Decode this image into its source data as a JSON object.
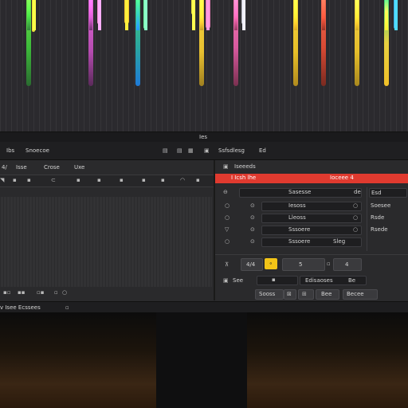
{
  "window": {
    "title": "Ies",
    "app_name": "Ibs",
    "menu_label": "Snoecoe",
    "header_right": "Ssfsdlesg",
    "header_right_tag": "Ed"
  },
  "toolbar": {
    "item1": "4/",
    "item2": "Isse",
    "item3": "Crose",
    "item4": "Uxe"
  },
  "right_panel": {
    "section_title": "Iseeeds",
    "alert_left": "I Icsh lhe",
    "alert_right": "Ioceee 4",
    "rows": [
      {
        "col1": "Sasesse",
        "col2": "de"
      },
      {
        "col1": "Iesoss",
        "col2": ""
      },
      {
        "col1": "Lleoss",
        "col2": ""
      },
      {
        "col1": "Sssoere",
        "col2": "Sleg"
      }
    ],
    "side_labels": [
      "Esd",
      "Soesee",
      "Rsde",
      "Rsede"
    ],
    "controls": {
      "field1": "4/4",
      "field2": "5",
      "field3": "4"
    },
    "footer_left": "See",
    "footer_mid": "Edisaoses",
    "footer_mid_tag": "Be",
    "buttons": [
      "Sooss",
      "Bee",
      "Becee"
    ]
  },
  "status": {
    "text": "v Isee Ecssees"
  },
  "colors": {
    "accent_red": "#e03a2f",
    "accent_yellow": "#f2c417",
    "panel_bg": "#2a2a2c",
    "track_bg": "#323234"
  }
}
